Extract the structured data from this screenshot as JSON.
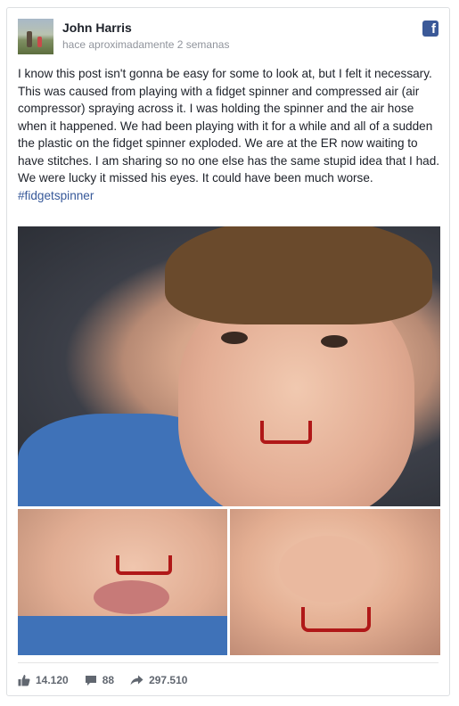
{
  "post": {
    "author": "John Harris",
    "time": "hace aproximadamente 2 semanas",
    "text": "I know this post isn't gonna be easy for some to look at, but I felt it necessary. This was caused from playing with a fidget spinner and compressed air (air compressor) spraying across it. I was holding the spinner and the air hose when it happened. We had been playing with it for a while and all of a sudden the plastic on the fidget spinner exploded. We are at the ER now waiting to have stitches. I am sharing so no one else has the same stupid idea that I had. We were lucky it missed his eyes. It could have been much worse.",
    "hashtag": "#fidgetspinner",
    "platform_icon": "f"
  },
  "stats": {
    "likes": "14.120",
    "comments": "88",
    "shares": "297.510"
  },
  "icons": {
    "platform": "facebook-icon",
    "like": "thumbs-up-icon",
    "comment": "comment-bubble-icon",
    "share": "share-arrow-icon"
  },
  "colors": {
    "facebook_blue": "#3b5998",
    "link": "#365899",
    "meta_gray": "#90949c",
    "stat_gray": "#616770"
  }
}
